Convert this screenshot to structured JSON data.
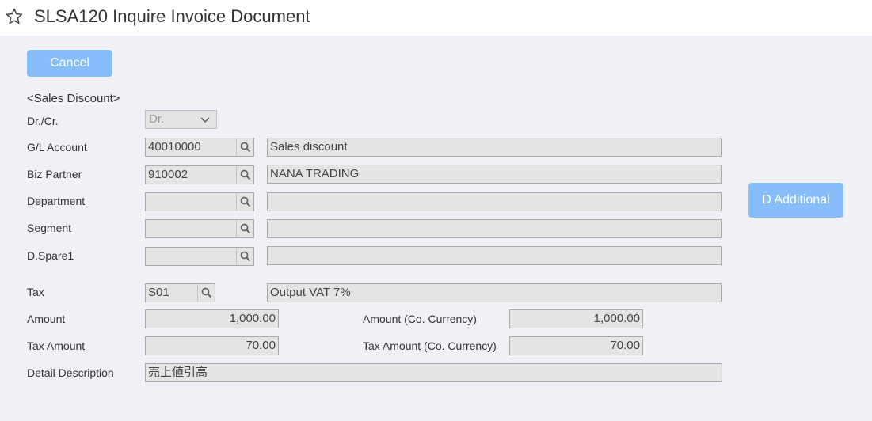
{
  "header": {
    "title": "SLSA120 Inquire Invoice Document"
  },
  "toolbar": {
    "cancel_label": "Cancel"
  },
  "section": {
    "title": "<Sales Discount>"
  },
  "labels": {
    "drcr": "Dr./Cr.",
    "gl_account": "G/L Account",
    "biz_partner": "Biz Partner",
    "department": "Department",
    "segment": "Segment",
    "dspare1": "D.Spare1",
    "tax": "Tax",
    "amount": "Amount",
    "amount_co": "Amount (Co. Currency)",
    "tax_amount": "Tax Amount",
    "tax_amount_co": "Tax Amount (Co. Currency)",
    "detail_description": "Detail Description"
  },
  "values": {
    "drcr": "Dr.",
    "gl_account_code": "40010000",
    "gl_account_name": "Sales discount",
    "biz_partner_code": "910002",
    "biz_partner_name": "NANA TRADING",
    "department_code": "",
    "department_name": "",
    "segment_code": "",
    "segment_name": "",
    "dspare1_code": "",
    "dspare1_name": "",
    "tax_code": "S01",
    "tax_name": "Output VAT 7%",
    "amount": "1,000.00",
    "amount_co": "1,000.00",
    "tax_amount": "70.00",
    "tax_amount_co": "70.00",
    "detail_description": "売上値引高"
  },
  "side": {
    "additional_label": "D Additional"
  },
  "icons": {
    "favorite": "star-outline-icon",
    "lookup": "search-icon",
    "dropdown": "chevron-down-icon"
  },
  "colors": {
    "button": "#88bdfb",
    "background": "#eff1f7",
    "field": "#e4e4e4"
  }
}
